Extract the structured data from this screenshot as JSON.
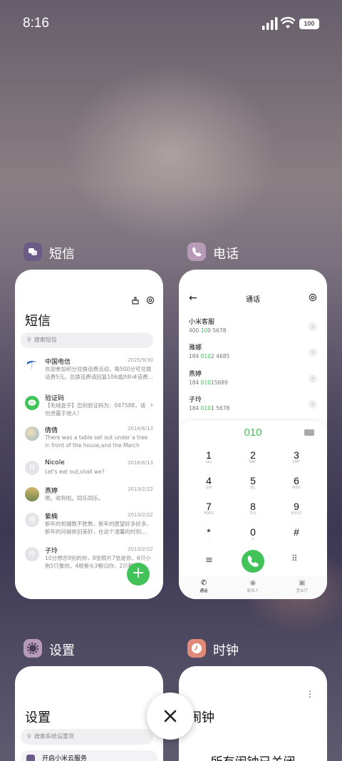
{
  "status": {
    "time": "8:16",
    "battery": "100"
  },
  "apps": {
    "sms": {
      "name": "短信",
      "icon": "chat-bubbles-icon",
      "color": "#6a5a86"
    },
    "phone": {
      "name": "电话",
      "icon": "phone-icon",
      "color": "#b79ab8"
    },
    "settings": {
      "name": "设置",
      "icon": "gear-icon",
      "color": "#b79ab8"
    },
    "clock": {
      "name": "时钟",
      "icon": "clock-icon",
      "color": "#e28a7a"
    }
  },
  "sms": {
    "title": "短信",
    "search_placeholder": "搜索短信",
    "messages": [
      {
        "name": "中国电信",
        "date": "2025/9/30",
        "text": "欢迎参加积分兑换话费活动，每500分可兑换话费5元。兑换话费请回复106或jfdh#话费..."
      },
      {
        "name": "验证码",
        "date": "",
        "text": "【毛绒盒子】您的验证码为：047588，请勿泄露于他人！"
      },
      {
        "name": "倩倩",
        "date": "2016/6/13",
        "text": "There was a table set out under a tree in front of the house,and the March Hare an..."
      },
      {
        "name": "Nicole",
        "date": "2016/6/13",
        "text": "Let's eat out,shall we?"
      },
      {
        "name": "燕婷",
        "date": "2013/2/22",
        "text": "嗯。收到啦。同乐同乐。"
      },
      {
        "name": "紫楠",
        "date": "2013/2/22",
        "text": "新年的祝福数不胜数，新年的愿望好多好多，新年的问候依旧美好，在这个温馨的时刻..."
      },
      {
        "name": "子玲",
        "date": "2013/2/22",
        "text": "10分想念9别的你，8张照片7张是你，6只小狗5只像你，4根骨头3根归你，2爪都归你..."
      }
    ],
    "avatar_initials": {
      "nicole": "N",
      "zinan": "楠",
      "ziling": "玲"
    }
  },
  "phone": {
    "title": "通话",
    "contacts": [
      {
        "name": "小米客服",
        "pre": "400 ",
        "hl": "10",
        "post": "0 5678"
      },
      {
        "name": "雅娜",
        "pre": "184 ",
        "hl": "010",
        "post": "2 4685"
      },
      {
        "name": "燕婷",
        "pre": "184 ",
        "hl": "010",
        "post": "15689"
      },
      {
        "name": "子玲",
        "pre": "184 ",
        "hl": "010",
        "post": "1 5678"
      }
    ],
    "dialed": "010",
    "keys": [
      {
        "d": "1",
        "l": "ωω"
      },
      {
        "d": "2",
        "l": "ABC"
      },
      {
        "d": "3",
        "l": "DEF"
      },
      {
        "d": "4",
        "l": "GHI"
      },
      {
        "d": "5",
        "l": "JKL"
      },
      {
        "d": "6",
        "l": "MNO"
      },
      {
        "d": "7",
        "l": "PQRS"
      },
      {
        "d": "8",
        "l": "TUV"
      },
      {
        "d": "9",
        "l": "WXYZ"
      },
      {
        "d": "*",
        "l": ","
      },
      {
        "d": "0",
        "l": "+"
      },
      {
        "d": "#",
        "l": ""
      }
    ],
    "tabs": [
      "通话",
      "联系人",
      "营业厅"
    ]
  },
  "settings": {
    "title": "设置",
    "search_placeholder": "搜索系统设置项",
    "first_item": "开启小米云服务"
  },
  "clock": {
    "title": "闹钟",
    "status": "所有闹钟已关闭"
  }
}
